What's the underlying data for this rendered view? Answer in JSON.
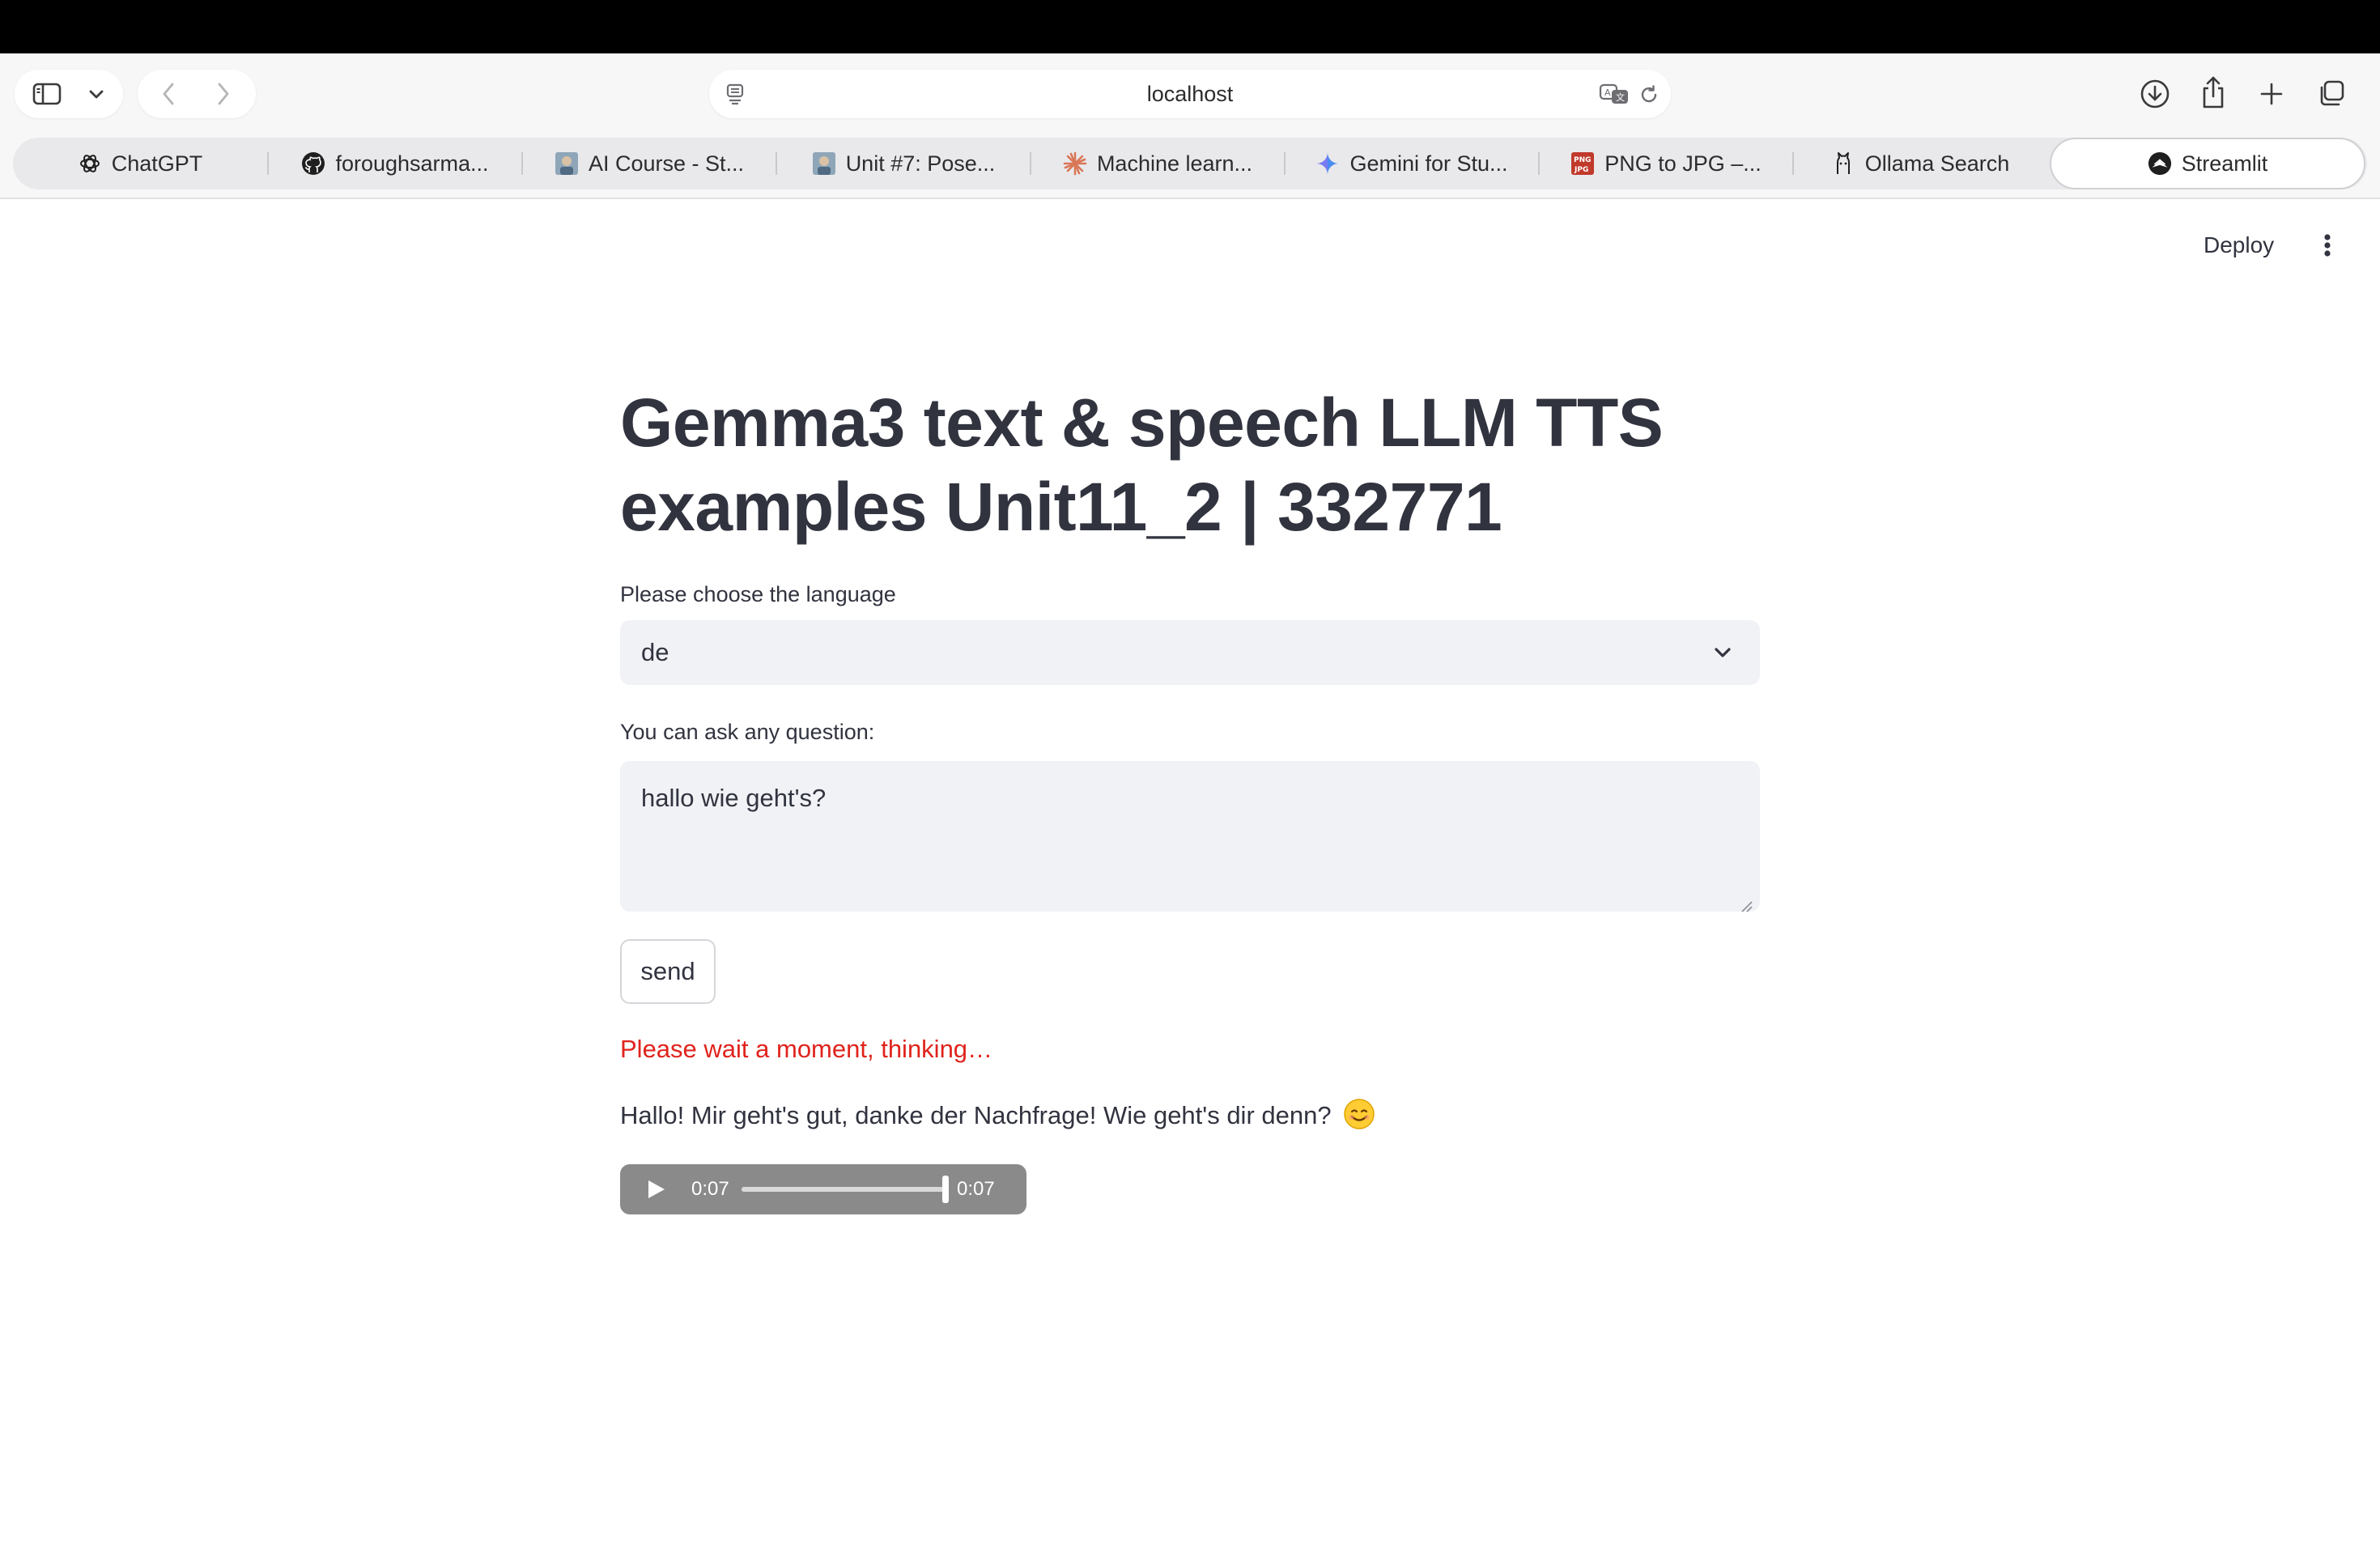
{
  "browser": {
    "url": "localhost",
    "tabs": [
      {
        "label": "ChatGPT",
        "icon": "chatgpt-icon"
      },
      {
        "label": "foroughsarma...",
        "icon": "github-icon"
      },
      {
        "label": "AI Course - St...",
        "icon": "course-thumbnail-icon"
      },
      {
        "label": "Unit #7: Pose...",
        "icon": "course-thumbnail-icon"
      },
      {
        "label": "Machine learn...",
        "icon": "sparkle-asterisk-icon"
      },
      {
        "label": "Gemini for Stu...",
        "icon": "gemini-icon"
      },
      {
        "label": "PNG to JPG –...",
        "icon": "png-jpg-icon"
      },
      {
        "label": "Ollama Search",
        "icon": "ollama-icon"
      },
      {
        "label": "Streamlit",
        "icon": "streamlit-icon",
        "active": true
      }
    ]
  },
  "app": {
    "deploy_label": "Deploy",
    "title": "Gemma3 text & speech LLM TTS examples Unit11_2 | 332771",
    "language_label": "Please choose the language",
    "language_value": "de",
    "question_label": "You can ask any question:",
    "question_value": "hallo wie geht's?",
    "send_label": "send",
    "status_text": "Please wait a moment, thinking…",
    "answer_text": "Hallo! Mir geht's gut, danke der Nachfrage! Wie geht's dir denn?",
    "audio": {
      "current_time": "0:07",
      "duration": "0:07",
      "progress": 1.0
    }
  },
  "colors": {
    "status_red": "#e0231c",
    "text": "#31333f",
    "input_bg": "#f0f2f6"
  }
}
